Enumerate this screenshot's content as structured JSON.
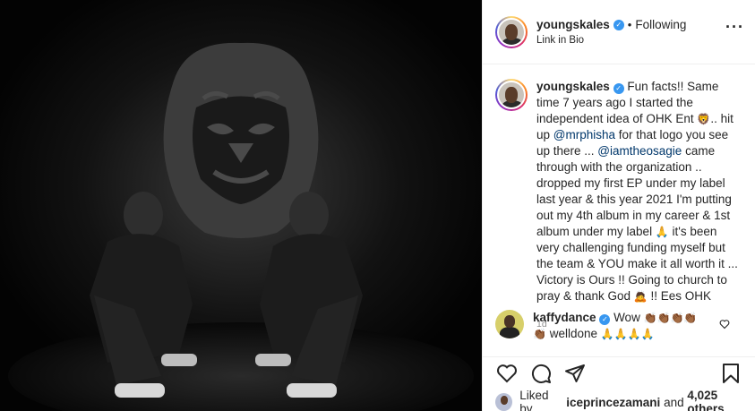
{
  "header": {
    "username": "youngskales",
    "separator": "•",
    "follow_status": "Following",
    "subtitle": "Link in Bio",
    "more": "···"
  },
  "caption": {
    "username": "youngskales",
    "text_1": "Fun facts!! Same time 7 years ago I started the independent idea of OHK Ent ",
    "emoji_lion": "🦁",
    "text_2": ".. hit up ",
    "mention_1": "@mrphisha",
    "text_3": " for that logo you see up there ... ",
    "mention_2": "@iamtheosagie",
    "text_4": " came through with the organization .. dropped my first EP under my label last year & this year 2021 I'm putting out my 4th album in my career & 1st album under my label ",
    "emoji_pray": "🙏",
    "text_5": " it's been very challenging funding myself but the team & YOU make it all worth it ... Victory is Ours !! Going to church to pray & thank God ",
    "emoji_person": "🙇",
    "text_6": " !! Ees OHK",
    "age": "1d"
  },
  "comment": {
    "username": "kaffydance",
    "text_1": " Wow ",
    "emoji_clap": "👏🏾👏🏾👏🏾👏🏾",
    "emoji_clap_2": "👏🏾",
    "text_2": " welldone ",
    "emoji_pray": "🙏🙏🙏🙏"
  },
  "likes": {
    "prefix": "Liked by ",
    "user": "iceprincezamani",
    "middle": " and ",
    "count": "4,025 others"
  },
  "icons": [
    "like-icon",
    "comment-icon",
    "share-icon",
    "save-icon",
    "verified-icon",
    "small-heart-icon"
  ],
  "colors": {
    "accent": "#3897f0",
    "mention": "#00376b",
    "muted": "#8e8e8e",
    "media_bg": "#050505"
  }
}
